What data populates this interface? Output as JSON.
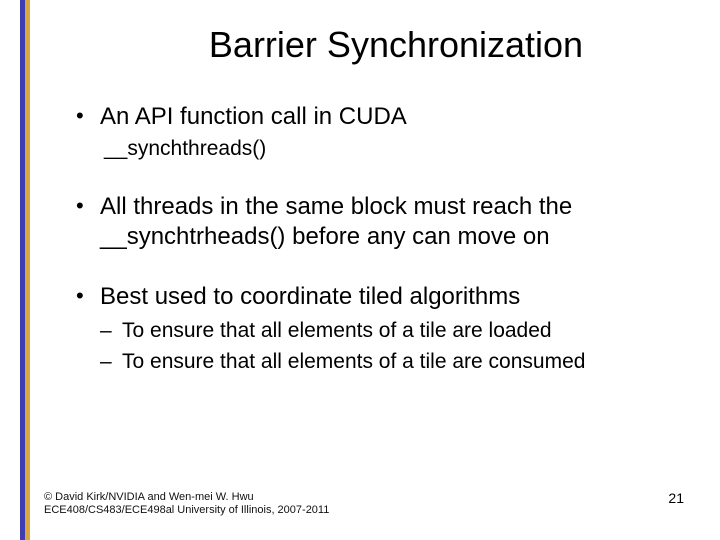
{
  "title": "Barrier Synchronization",
  "bullets": [
    {
      "text": "An API function call in CUDA",
      "sub_plain": "__synchthreads()"
    },
    {
      "text": "All threads in the same block must reach the __synchtrheads() before any can move on"
    },
    {
      "text": "Best used to coordinate tiled algorithms",
      "sub_dash": [
        "To ensure that all elements of a tile are loaded",
        "To ensure that all elements of a tile are consumed"
      ]
    }
  ],
  "footer_line1": "© David Kirk/NVIDIA and Wen-mei W. Hwu",
  "footer_line2": "ECE408/CS483/ECE498al University of Illinois, 2007-2011",
  "page_number": "21"
}
